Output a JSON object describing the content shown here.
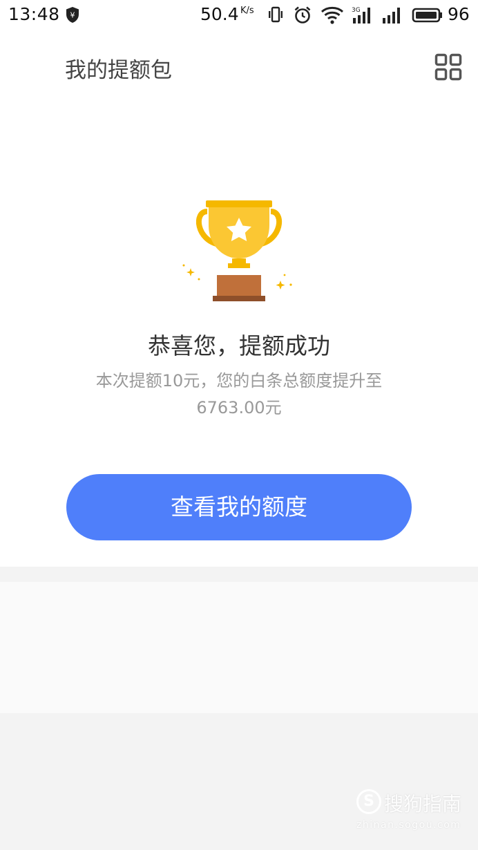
{
  "status_bar": {
    "time": "13:48",
    "network_speed": "50.4",
    "network_speed_unit": "K/s",
    "network_type": "3G",
    "battery_level": "96",
    "icons": [
      "shield-yen-icon",
      "vibrate-icon",
      "alarm-icon",
      "wifi-icon",
      "signal-3g-icon",
      "signal-icon",
      "battery-icon"
    ]
  },
  "header": {
    "title": "我的提额包",
    "menu_icon": "grid-icon"
  },
  "result": {
    "icon": "trophy-icon",
    "title": "恭喜您，提额成功",
    "description": "本次提额10元，您的白条总额度提升至6763.00元",
    "button_label": "查看我的额度"
  },
  "watermark": {
    "logo_letter": "S",
    "text": "搜狗指南",
    "url": "zhinan.sogou.com"
  },
  "colors": {
    "accent": "#4f7ffa",
    "trophy_gold": "#fbc02d",
    "trophy_base": "#c0703a",
    "background": "#f3f3f3"
  }
}
